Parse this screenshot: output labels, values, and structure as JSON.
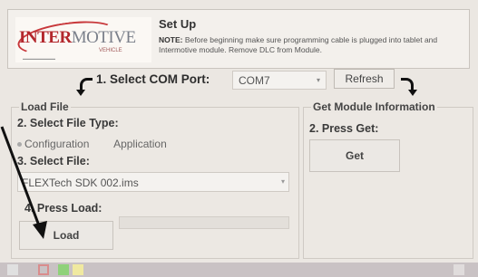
{
  "header": {
    "logo_inter": "INTER",
    "logo_motive": "MOTIVE",
    "logo_sub": "VEHICLE",
    "title": "Set Up",
    "note_label": "NOTE:",
    "note_text": "Before beginning make sure programming cable is plugged into tablet and Intermotive module. Remove DLC from Module."
  },
  "com_port": {
    "label": "1. Select COM Port:",
    "value": "COM7",
    "refresh_label": "Refresh"
  },
  "load_file": {
    "title": "Load File",
    "step2": "2. Select File Type:",
    "file_types": [
      "Configuration",
      "Application"
    ],
    "step3": "3. Select File:",
    "file_value": "FLEXTech SDK 002.ims",
    "step4": "4. Press Load:",
    "load_label": "Load"
  },
  "get_module": {
    "title": "Get Module Information",
    "step2": "2. Press Get:",
    "get_label": "Get"
  },
  "colors": {
    "accent_red": "#b3272c",
    "background": "#ebe7e2"
  }
}
